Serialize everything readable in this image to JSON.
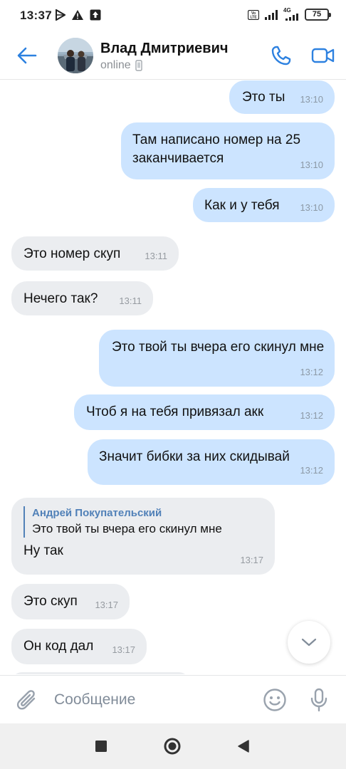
{
  "status_bar": {
    "time": "13:37",
    "network": "4G",
    "battery": "75"
  },
  "header": {
    "contact_name": "Влад Дмитриевич",
    "contact_status": "online"
  },
  "messages": [
    {
      "dir": "out",
      "text": "Это ты",
      "time": "13:10"
    },
    {
      "dir": "out",
      "text": "Там написано номер на 25 заканчивается",
      "time": "13:10"
    },
    {
      "dir": "out",
      "text": "Как и у тебя",
      "time": "13:10"
    },
    {
      "dir": "in",
      "text": "Это номер скуп",
      "time": "13:11"
    },
    {
      "dir": "in",
      "text": "Нечего так?",
      "time": "13:11"
    },
    {
      "dir": "out",
      "text": "Это твой ты вчера его скинул мне",
      "time": "13:12"
    },
    {
      "dir": "out",
      "text": "Чтоб я на тебя привязал акк",
      "time": "13:12"
    },
    {
      "dir": "out",
      "text": "Значит бибки за них скидывай",
      "time": "13:12"
    },
    {
      "dir": "in",
      "reply_author": "Андрей Покупательский",
      "reply_text": "Это твой ты вчера его скинул мне",
      "text": "Ну так",
      "time": "13:17"
    },
    {
      "dir": "in",
      "text": "Это скуп",
      "time": "13:17"
    },
    {
      "dir": "in",
      "text": "Он код дал",
      "time": "13:17"
    }
  ],
  "composer": {
    "placeholder": "Сообщение"
  },
  "colors": {
    "accent": "#2d81e0",
    "outgoing_bubble": "#cce4ff",
    "incoming_bubble": "#ebedf0"
  },
  "icons": [
    "back-arrow-icon",
    "phone-icon",
    "video-camera-icon",
    "paperclip-icon",
    "emoji-icon",
    "microphone-icon",
    "chevron-down-icon",
    "home-icon",
    "back-icon",
    "recents-icon"
  ]
}
